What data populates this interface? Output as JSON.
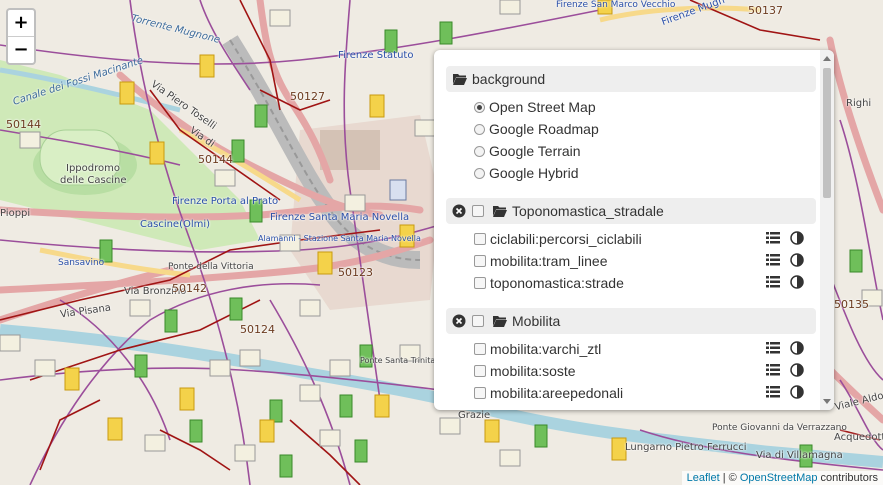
{
  "map": {
    "labels": {
      "canale": "Canale dei Fossi Macinante",
      "torrente": "Torrente Mugnone",
      "ippodromo1": "Ippodromo",
      "ippodromo2": "delle Cascine",
      "statuto": "Firenze Statuto",
      "porta_prato": "Firenze Porta al Prato",
      "smn": "Firenze Santa Maria Novella",
      "cascine": "Cascine(Olmi)",
      "alamanni": "Alamanni - Stazione Santa Maria Novella",
      "sansavino": "Sansavino",
      "bronzino": "Via Bronzino",
      "pisana": "Via Pisana",
      "pioppi": "Pioppi",
      "piero_toselli": "Via Piero Toselli",
      "via_di": "Via di",
      "ponte_vittoria": "Ponte della Vittoria",
      "ponte_trinita": "Ponte Santa Trinita",
      "ponte_verrazzano": "Ponte Giovanni da Verrazzano",
      "lungarno": "Lungarno Pietro Ferrucci",
      "aldo_moro": "Viale Aldo Moro",
      "acquedotto": "Acquedotto dell'Ancona",
      "villamagna": "Via di Villamagna",
      "san_marco": "Firenze San Marco Vecchio",
      "righi": "Righi",
      "grazie": "Grazie",
      "code_50137": "50137",
      "code_50144": "50144",
      "code_50127": "50127",
      "code_50141": "50144",
      "code_50123": "50123",
      "code_50142": "50142",
      "code_50135": "50135",
      "code_50124": "50124",
      "mugnone_top": "Firenze Mugn"
    }
  },
  "zoom": {
    "in_label": "+",
    "out_label": "−"
  },
  "panel": {
    "background_label": "background",
    "base_layers": [
      {
        "label": "Open Street Map",
        "checked": true
      },
      {
        "label": "Google Roadmap",
        "checked": false
      },
      {
        "label": "Google Terrain",
        "checked": false
      },
      {
        "label": "Google Hybrid",
        "checked": false
      }
    ],
    "groups": [
      {
        "name": "Toponomastica_stradale",
        "layers": [
          "ciclabili:percorsi_ciclabili",
          "mobilita:tram_linee",
          "toponomastica:strade"
        ]
      },
      {
        "name": "Mobilita",
        "layers": [
          "mobilita:varchi_ztl",
          "mobilita:soste",
          "mobilita:areepedonali"
        ]
      }
    ]
  },
  "attribution": {
    "leaflet": "Leaflet",
    "sep": " | © ",
    "osm": "OpenStreetMap",
    "suffix": " contributors"
  }
}
